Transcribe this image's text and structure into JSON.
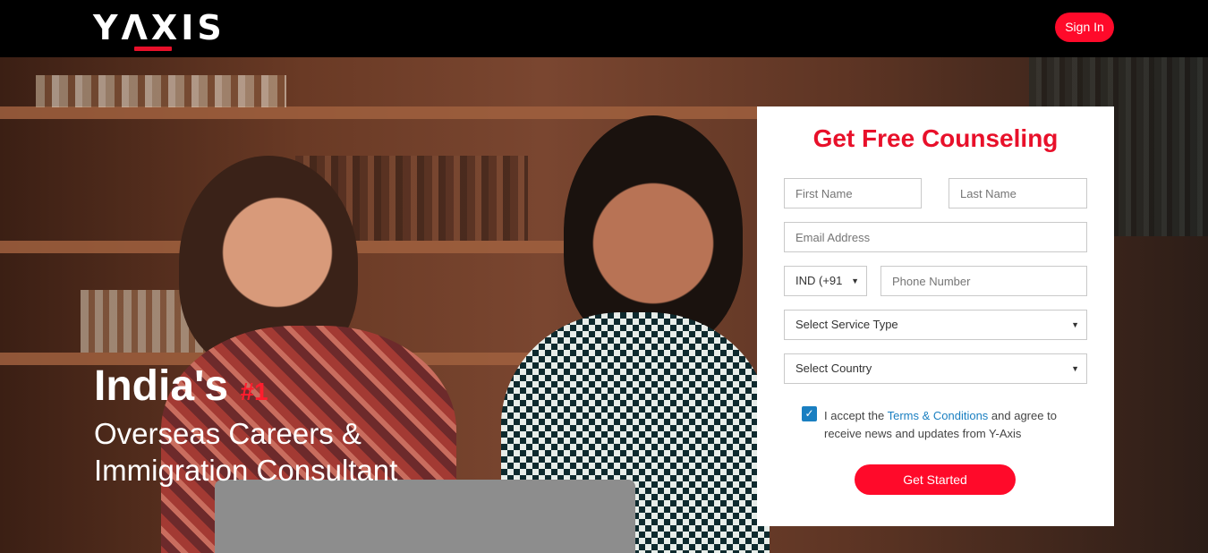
{
  "header": {
    "logo_text": "YΛXIS",
    "signin_label": "Sign In"
  },
  "hero": {
    "title_line1": "India's",
    "title_rank": "#1",
    "title_line2": "Overseas Careers &",
    "title_line3": "Immigration Consultant"
  },
  "form": {
    "title": "Get Free Counseling",
    "first_name_placeholder": "First Name",
    "last_name_placeholder": "Last Name",
    "email_placeholder": "Email Address",
    "country_code_value": "IND (+91",
    "phone_placeholder": "Phone Number",
    "service_type_value": "Select Service Type",
    "country_value": "Select Country",
    "consent_prefix": "I accept the ",
    "consent_link": "Terms & Conditions",
    "consent_suffix": " and agree to receive news and updates from Y-Axis",
    "consent_checked": true,
    "submit_label": "Get Started"
  },
  "colors": {
    "brand_red": "#ff0a2a",
    "link_blue": "#1a7fc1"
  },
  "icons": {
    "dropdown": "caret-down-icon",
    "checkbox": "checkmark-icon"
  }
}
